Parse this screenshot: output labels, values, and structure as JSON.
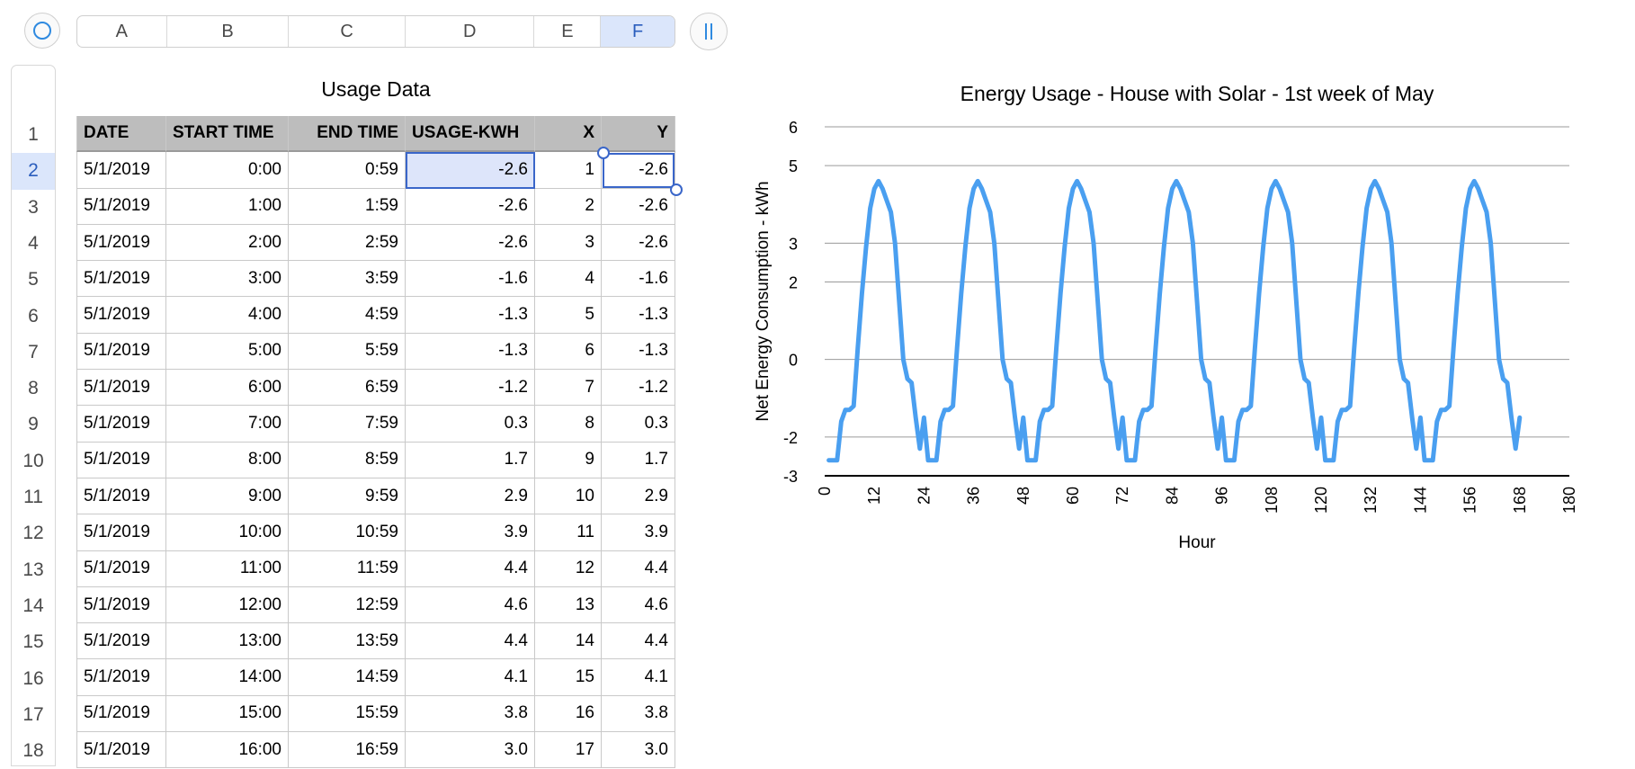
{
  "columns": [
    "A",
    "B",
    "C",
    "D",
    "E",
    "F"
  ],
  "active_column": "F",
  "active_row": "2",
  "rows": [
    "1",
    "2",
    "3",
    "4",
    "5",
    "6",
    "7",
    "8",
    "9",
    "10",
    "11",
    "12",
    "13",
    "14",
    "15",
    "16",
    "17",
    "18"
  ],
  "table": {
    "title": "Usage Data",
    "headers": [
      "DATE",
      "START TIME",
      "END TIME",
      "USAGE-KWH",
      "X",
      "Y"
    ],
    "data": [
      [
        "5/1/2019",
        "0:00",
        "0:59",
        "-2.6",
        "1",
        "-2.6"
      ],
      [
        "5/1/2019",
        "1:00",
        "1:59",
        "-2.6",
        "2",
        "-2.6"
      ],
      [
        "5/1/2019",
        "2:00",
        "2:59",
        "-2.6",
        "3",
        "-2.6"
      ],
      [
        "5/1/2019",
        "3:00",
        "3:59",
        "-1.6",
        "4",
        "-1.6"
      ],
      [
        "5/1/2019",
        "4:00",
        "4:59",
        "-1.3",
        "5",
        "-1.3"
      ],
      [
        "5/1/2019",
        "5:00",
        "5:59",
        "-1.3",
        "6",
        "-1.3"
      ],
      [
        "5/1/2019",
        "6:00",
        "6:59",
        "-1.2",
        "7",
        "-1.2"
      ],
      [
        "5/1/2019",
        "7:00",
        "7:59",
        "0.3",
        "8",
        "0.3"
      ],
      [
        "5/1/2019",
        "8:00",
        "8:59",
        "1.7",
        "9",
        "1.7"
      ],
      [
        "5/1/2019",
        "9:00",
        "9:59",
        "2.9",
        "10",
        "2.9"
      ],
      [
        "5/1/2019",
        "10:00",
        "10:59",
        "3.9",
        "11",
        "3.9"
      ],
      [
        "5/1/2019",
        "11:00",
        "11:59",
        "4.4",
        "12",
        "4.4"
      ],
      [
        "5/1/2019",
        "12:00",
        "12:59",
        "4.6",
        "13",
        "4.6"
      ],
      [
        "5/1/2019",
        "13:00",
        "13:59",
        "4.4",
        "14",
        "4.4"
      ],
      [
        "5/1/2019",
        "14:00",
        "14:59",
        "4.1",
        "15",
        "4.1"
      ],
      [
        "5/1/2019",
        "15:00",
        "15:59",
        "3.8",
        "16",
        "3.8"
      ],
      [
        "5/1/2019",
        "16:00",
        "16:59",
        "3.0",
        "17",
        "3.0"
      ]
    ]
  },
  "chart_data": {
    "type": "line",
    "title": "Energy Usage - House with Solar - 1st week of May",
    "xlabel": "Hour",
    "ylabel": "Net Energy Consumption - kWh",
    "xlim": [
      0,
      180
    ],
    "ylim": [
      -3,
      6
    ],
    "x_ticks": [
      "0",
      "12",
      "24",
      "36",
      "48",
      "60",
      "72",
      "84",
      "96",
      "108",
      "120",
      "132",
      "144",
      "156",
      "168",
      "180"
    ],
    "y_ticks": [
      "-3",
      "-2",
      "0",
      "2",
      "3",
      "5",
      "6"
    ],
    "grid": true,
    "color": "#4a9ff0",
    "day_profile": [
      -2.6,
      -2.6,
      -2.6,
      -1.6,
      -1.3,
      -1.3,
      -1.2,
      0.3,
      1.7,
      2.9,
      3.9,
      4.4,
      4.6,
      4.4,
      4.1,
      3.8,
      3.0,
      1.5,
      0.0,
      -0.5,
      -0.6,
      -1.5,
      -2.3,
      -1.5
    ],
    "days": 7
  }
}
